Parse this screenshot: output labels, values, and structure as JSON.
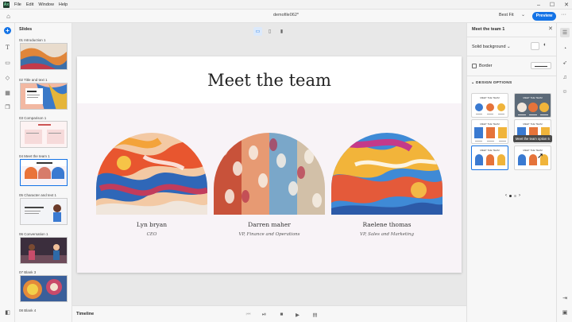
{
  "menu": {
    "logo": "Ax",
    "items": [
      "File",
      "Edit",
      "Window",
      "Help"
    ]
  },
  "window_controls": {
    "minimize": "–",
    "maximize": "☐",
    "close": "✕"
  },
  "toolbar": {
    "doc_name": "demofile062*",
    "zoom_label": "Best Fit",
    "preview_label": "Preview",
    "more_label": "···"
  },
  "left_rail": {
    "icons": [
      "add-icon",
      "text-icon",
      "media-icon",
      "shapes-icon",
      "grid-icon",
      "layers-icon"
    ]
  },
  "slides_panel": {
    "title": "Slides",
    "items": [
      {
        "label": "01   Introduction 1",
        "selected": false
      },
      {
        "label": "02   Title and text 1",
        "selected": false
      },
      {
        "label": "03   Comparison 1",
        "selected": false
      },
      {
        "label": "04   Meet the team 1",
        "selected": true
      },
      {
        "label": "05   Character and text 1",
        "selected": false
      },
      {
        "label": "06   Conversation 1",
        "selected": false
      },
      {
        "label": "07   Blank 3",
        "selected": false
      },
      {
        "label": "08   Blank 4",
        "selected": false
      }
    ]
  },
  "slide": {
    "title": "Meet the team",
    "members": [
      {
        "name": "Lyn bryan",
        "role": "CEO"
      },
      {
        "name": "Darren maher",
        "role": "VP, Finance and Operations"
      },
      {
        "name": "Raelene thomas",
        "role": "VP, Sales and Marketing"
      }
    ]
  },
  "timeline": {
    "label": "Timeline"
  },
  "right_panel": {
    "title": "Meet the team 1",
    "background_label": "Solid background",
    "border_label": "Border",
    "design_options_label": "DESIGN OPTIONS",
    "option_title": "MEET THE TEAM",
    "tooltip": "Meet the team option 5",
    "pager": {
      "prev": "‹",
      "next": "›"
    }
  },
  "colors": {
    "accent": "#1473e6",
    "slide_bg": "#f8f3f7"
  }
}
